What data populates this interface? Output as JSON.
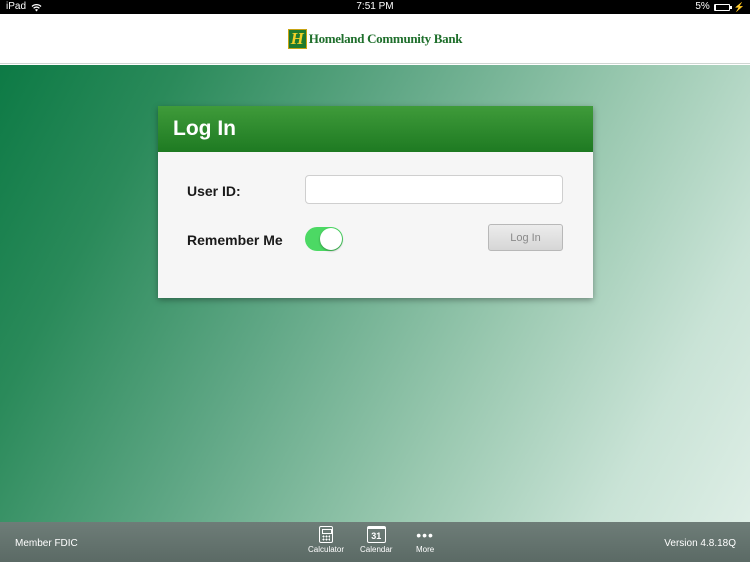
{
  "status_bar": {
    "device": "iPad",
    "time": "7:51 PM",
    "battery_text": "5%",
    "battery_level": 0.05,
    "wifi_icon": "wifi-icon",
    "charging_icon": "bolt-icon"
  },
  "header": {
    "logo_letter": "H",
    "bank_name": "Homeland Community Bank"
  },
  "login": {
    "title": "Log In",
    "user_id_label": "User ID:",
    "user_id_value": "",
    "remember_label": "Remember Me",
    "remember_on": true,
    "login_button": "Log In"
  },
  "toolbar": {
    "left_text": "Member FDIC",
    "items": [
      {
        "label": "Calculator",
        "icon": "calculator-icon"
      },
      {
        "label": "Calendar",
        "icon": "calendar-icon",
        "icon_text": "31"
      },
      {
        "label": "More",
        "icon": "more-icon",
        "icon_text": "•••"
      }
    ],
    "version": "Version 4.8.18Q"
  },
  "colors": {
    "brand_green": "#1e7a22",
    "toggle_on": "#4cd964",
    "logo_gold": "#f2d028"
  }
}
